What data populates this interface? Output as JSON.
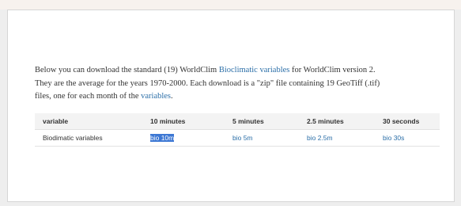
{
  "intro": {
    "l1_a": "Below you can download the standard (19) WorldClim ",
    "l1_link": "Bioclimatic variables",
    "l1_b": " for WorldClim version 2.",
    "l2": "They are the average for the years 1970-2000. Each download is a \"zip\" file containing 19 GeoTiff (.tif)",
    "l3_a": "files, one for each month of the ",
    "l3_link": "variables",
    "l3_b": "."
  },
  "table": {
    "headers": [
      "variable",
      "10 minutes",
      "5 minutes",
      "2.5 minutes",
      "30 seconds"
    ],
    "rows": [
      {
        "variable": "Biodimatic variables",
        "links": [
          "bio 10m",
          "bio 5m",
          "bio 2.5m",
          "bio 30s"
        ]
      }
    ]
  },
  "colors": {
    "link": "#2c6fa8",
    "selection": "#3d78d4"
  }
}
